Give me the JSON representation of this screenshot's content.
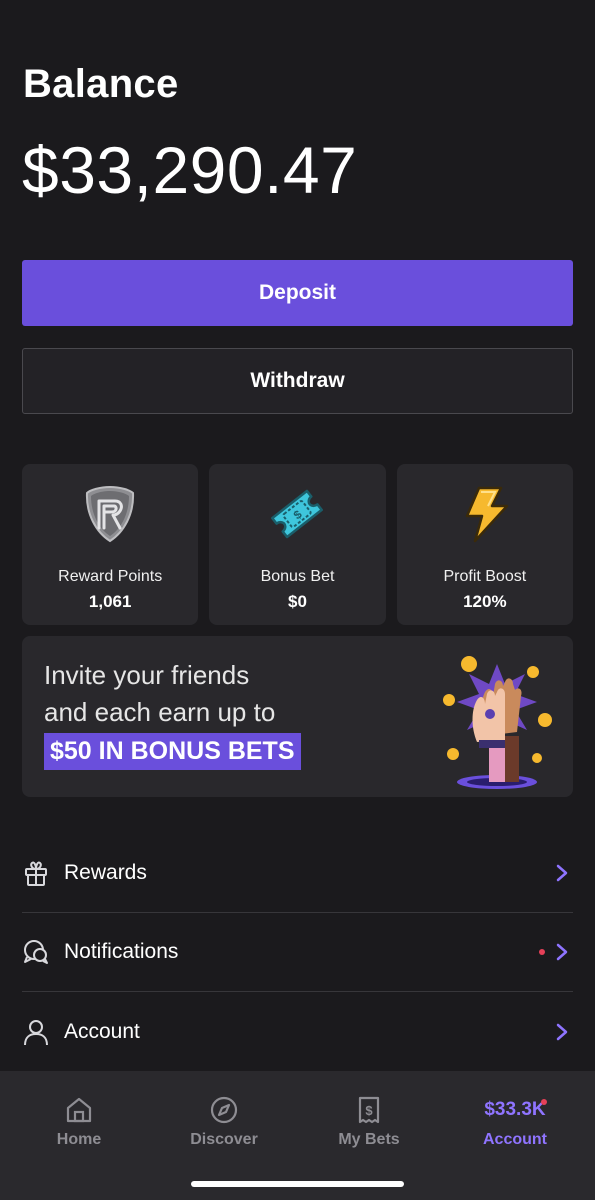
{
  "balance": {
    "label": "Balance",
    "amount": "$33,290.47"
  },
  "actions": {
    "deposit_label": "Deposit",
    "withdraw_label": "Withdraw"
  },
  "tiles": [
    {
      "icon": "reward-shield-icon",
      "label": "Reward Points",
      "value": "1,061"
    },
    {
      "icon": "bonus-ticket-icon",
      "label": "Bonus Bet",
      "value": "$0"
    },
    {
      "icon": "lightning-bolt-icon",
      "label": "Profit Boost",
      "value": "120%"
    }
  ],
  "promo": {
    "line1": "Invite your friends",
    "line2": "and each earn up to",
    "highlight": "$50 IN BONUS BETS"
  },
  "menu": [
    {
      "icon": "gift-icon",
      "label": "Rewards"
    },
    {
      "icon": "chat-bubbles-icon",
      "label": "Notifications",
      "has_dot": true
    },
    {
      "icon": "user-icon",
      "label": "Account"
    }
  ],
  "tabbar": {
    "home": "Home",
    "discover": "Discover",
    "mybets": "My Bets",
    "account_balance": "$33.3K",
    "account": "Account"
  },
  "colors": {
    "background": "#1b1a1d",
    "accent": "#6a4fdc",
    "accent_text": "#8f74ff",
    "notification_dot": "#e64058"
  }
}
